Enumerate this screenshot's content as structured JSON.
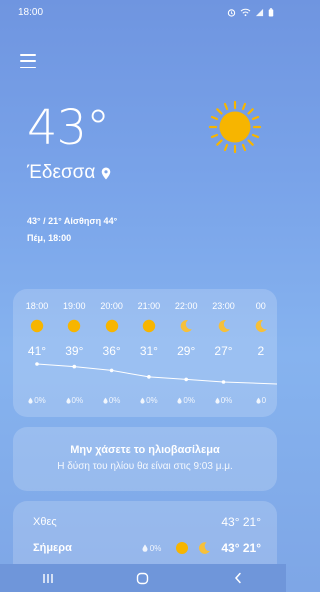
{
  "status_bar": {
    "time": "18:00"
  },
  "weather": {
    "current_temp": "43°",
    "city": "Έδεσσα",
    "hi_lo_feels": "43° / 21° Αίσθηση 44°",
    "day_time": "Πέμ, 18:00",
    "icon": "sun-icon"
  },
  "hourly": [
    {
      "time": "18:00",
      "temp": "41°",
      "rain": "0%",
      "icon": "sun"
    },
    {
      "time": "19:00",
      "temp": "39°",
      "rain": "0%",
      "icon": "sun"
    },
    {
      "time": "20:00",
      "temp": "36°",
      "rain": "0%",
      "icon": "sun"
    },
    {
      "time": "21:00",
      "temp": "31°",
      "rain": "0%",
      "icon": "sun"
    },
    {
      "time": "22:00",
      "temp": "29°",
      "rain": "0%",
      "icon": "moon"
    },
    {
      "time": "23:00",
      "temp": "27°",
      "rain": "0%",
      "icon": "moon"
    },
    {
      "time": "00",
      "temp": "2",
      "rain": "0",
      "icon": "moon"
    }
  ],
  "sunset_card": {
    "title": "Μην χάσετε το ηλιοβασίλεμα",
    "subtitle": "Η δύση του ηλίου θα είναι στις 9:03 μ.μ."
  },
  "daily": {
    "yesterday": {
      "name": "Χθες",
      "temps": "43° 21°"
    },
    "today": {
      "name": "Σήμερα",
      "rain": "0%",
      "temps": "43° 21°"
    }
  },
  "colors": {
    "sun": "#f7b500",
    "moon": "#f6c03a"
  }
}
